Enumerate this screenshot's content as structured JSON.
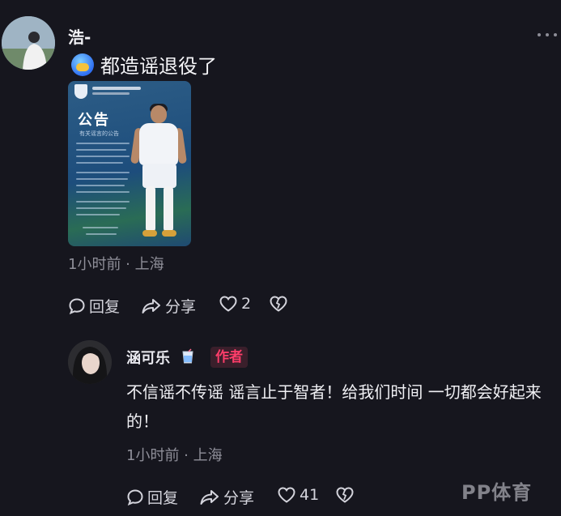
{
  "main_comment": {
    "username": "浩-",
    "text": "都造谣退役了",
    "poster": {
      "title": "公告",
      "subtitle": "有关谣言的公告"
    },
    "meta": "1小时前 · 上海",
    "actions": {
      "reply_label": "回复",
      "share_label": "分享",
      "like_count": "2"
    }
  },
  "reply": {
    "username": "涵可乐",
    "badge": "作者",
    "text": "不信谣不传谣 谣言止于智者！给我们时间 一切都会好起来的！",
    "meta": "1小时前 · 上海",
    "actions": {
      "reply_label": "回复",
      "share_label": "分享",
      "like_count": "41"
    }
  },
  "watermark": "PP体育",
  "colors": {
    "background": "#16161e",
    "author_badge_text": "#ff3d6a",
    "author_badge_bg": "#3a1f2b",
    "meta_text": "#8f8f99"
  },
  "icons": [
    "more-options-icon",
    "emoji-sticker-icon",
    "reply-icon",
    "share-icon",
    "heart-icon",
    "dislike-heart-icon",
    "cup-icon"
  ]
}
